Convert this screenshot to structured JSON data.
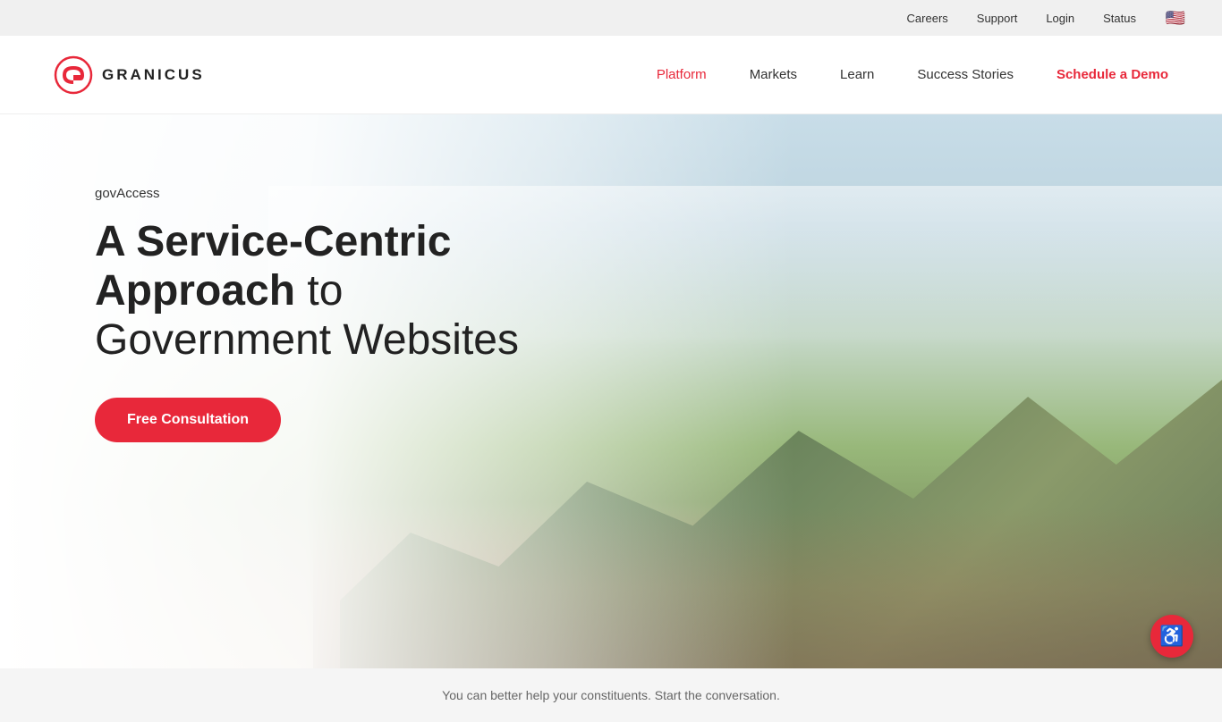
{
  "topbar": {
    "links": [
      {
        "label": "Careers",
        "id": "careers"
      },
      {
        "label": "Support",
        "id": "support"
      },
      {
        "label": "Login",
        "id": "login"
      },
      {
        "label": "Status",
        "id": "status"
      }
    ],
    "flag_icon": "🇺🇸"
  },
  "logo": {
    "text": "GRANICUS"
  },
  "nav": {
    "links": [
      {
        "label": "Platform",
        "id": "platform",
        "active": true
      },
      {
        "label": "Markets",
        "id": "markets",
        "active": false
      },
      {
        "label": "Learn",
        "id": "learn",
        "active": false
      },
      {
        "label": "Success Stories",
        "id": "success-stories",
        "active": false
      }
    ],
    "cta_label": "Schedule a Demo"
  },
  "hero": {
    "eyebrow": "govAccess",
    "title_bold": "A Service-Centric Approach",
    "title_rest": " to Government Websites",
    "cta_label": "Free Consultation"
  },
  "bottombar": {
    "text": "You can better help your constituents. Start the conversation."
  },
  "accessibility": {
    "label": "Accessibility",
    "icon": "♿"
  },
  "colors": {
    "accent": "#e8283a",
    "nav_active": "#e8283a"
  }
}
